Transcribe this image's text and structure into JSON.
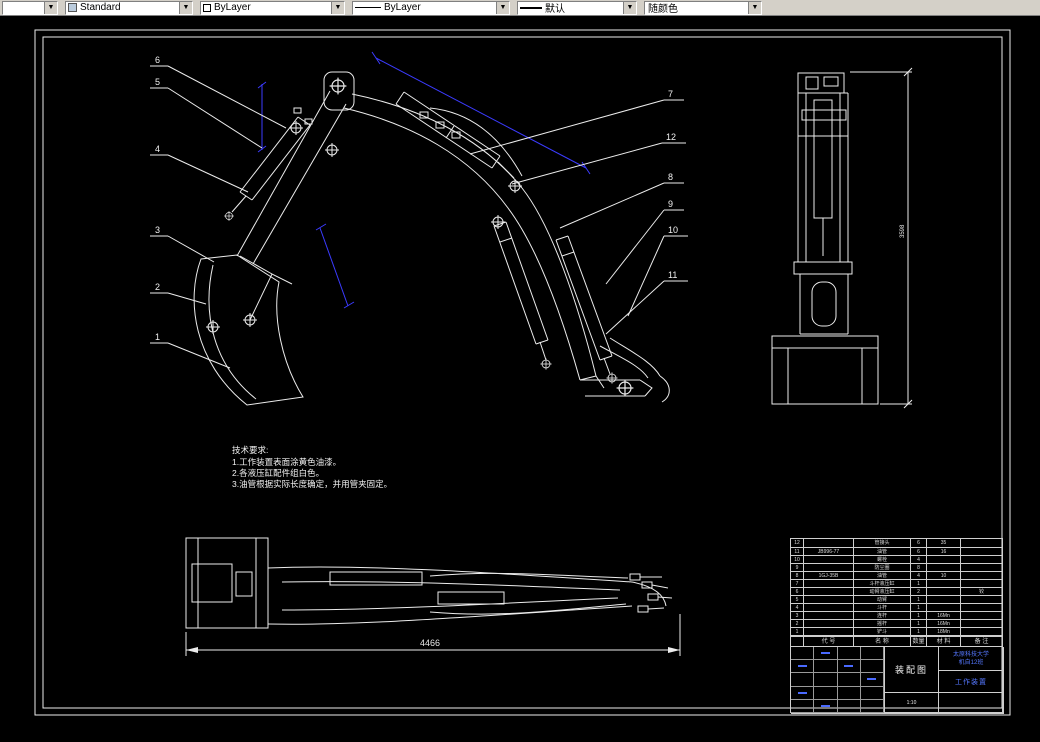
{
  "toolbar": {
    "combos": [
      {
        "value": ""
      },
      {
        "value": "Standard"
      },
      {
        "value": "ByLayer"
      },
      {
        "value": "ByLayer"
      },
      {
        "value": "默认"
      },
      {
        "value": "随颜色"
      }
    ]
  },
  "drawing": {
    "callouts": [
      "6",
      "5",
      "4",
      "3",
      "2",
      "1",
      "7",
      "12",
      "8",
      "9",
      "10",
      "11"
    ],
    "tech_requirements": {
      "title": "技术要求:",
      "line1": "1.工作装置表面涂黄色油漆。",
      "line2": "2.各液压缸配件组白色。",
      "line3": "3.油管根据实际长度确定，并用管夹固定。"
    },
    "dims": {
      "transport_length": "4466",
      "fold_height": "3598"
    }
  },
  "title_block": {
    "parts_rows": [
      {
        "num": "12",
        "code": "",
        "name": "管接头",
        "qty": "6",
        "material": "35",
        "remark": ""
      },
      {
        "num": "11",
        "code": "JB996-77",
        "name": "油管",
        "qty": "6",
        "material": "16",
        "remark": ""
      },
      {
        "num": "10",
        "code": "",
        "name": "螺栓",
        "qty": "4",
        "material": "",
        "remark": ""
      },
      {
        "num": "9",
        "code": "",
        "name": "防尘圈",
        "qty": "8",
        "material": "",
        "remark": ""
      },
      {
        "num": "8",
        "code": "1GJ-35B",
        "name": "油管",
        "qty": "4",
        "material": "10",
        "remark": ""
      },
      {
        "num": "7",
        "code": "",
        "name": "斗杆液压缸",
        "qty": "1",
        "material": "",
        "remark": ""
      },
      {
        "num": "6",
        "code": "",
        "name": "动臂液压缸",
        "qty": "2",
        "material": "",
        "remark": "铰"
      },
      {
        "num": "5",
        "code": "",
        "name": "动臂",
        "qty": "1",
        "material": "",
        "remark": ""
      },
      {
        "num": "4",
        "code": "",
        "name": "斗杆",
        "qty": "1",
        "material": "",
        "remark": ""
      },
      {
        "num": "3",
        "code": "",
        "name": "连杆",
        "qty": "1",
        "material": "16Mn",
        "remark": ""
      },
      {
        "num": "2",
        "code": "",
        "name": "摇杆",
        "qty": "1",
        "material": "16Mn",
        "remark": ""
      },
      {
        "num": "1",
        "code": "",
        "name": "铲斗",
        "qty": "1",
        "material": "18Mn",
        "remark": ""
      }
    ],
    "headers": {
      "code": "代 号",
      "name": "名 称",
      "qty": "数量",
      "material": "材 料",
      "remark": "备 注"
    },
    "school": "太原科技大学",
    "class_name": "机自12班",
    "doc_type": "装配图",
    "part_name": "工作装置",
    "scale": "1:10"
  }
}
